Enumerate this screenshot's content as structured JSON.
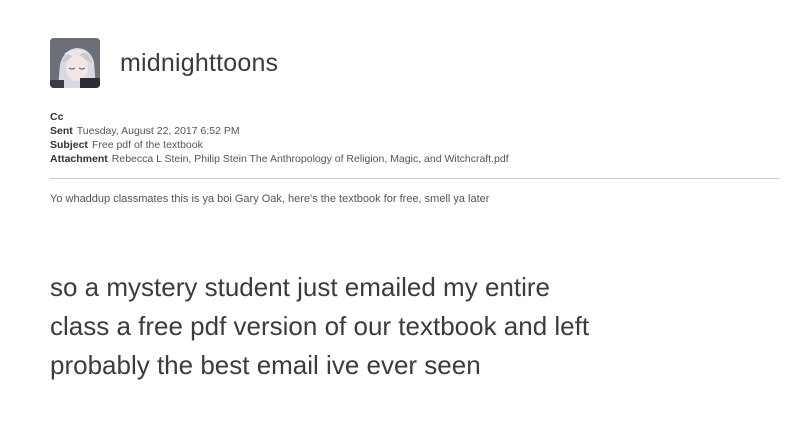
{
  "post": {
    "username": "midnighttoons",
    "avatar_icon": "anime-character-avatar"
  },
  "email": {
    "cc_label": "Cc",
    "sent_label": "Sent",
    "sent_value": "Tuesday, August 22, 2017 6:52 PM",
    "subject_label": "Subject",
    "subject_value": "Free pdf of the textbook",
    "attachment_label": "Attachment",
    "attachment_value": "Rebecca L Stein, Philip Stein The Anthropology of Religion, Magic, and Witchcraft.pdf",
    "body": "Yo whaddup classmates this is ya boi Gary Oak, here's the textbook for free, smell ya later"
  },
  "caption": {
    "line1": "so a mystery student just emailed my entire",
    "line2": "class a free pdf version of our textbook and left",
    "line3": "probably the best email ive ever seen"
  }
}
